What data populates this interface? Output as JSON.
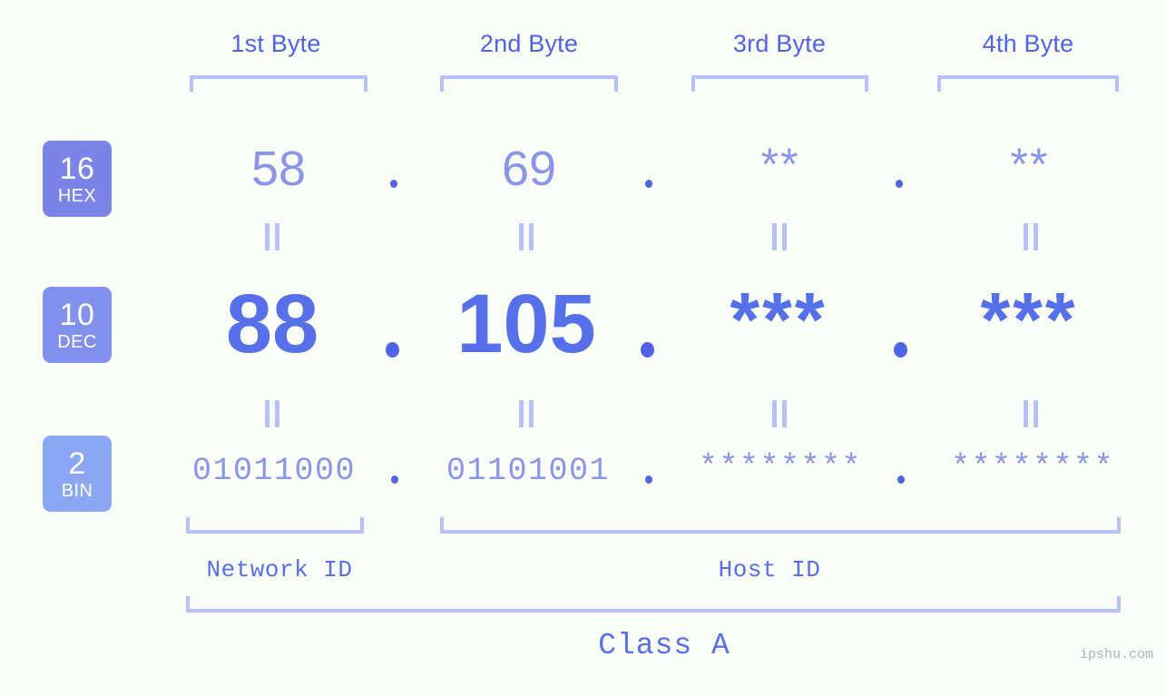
{
  "meta": {
    "background_color": "#fbfdf8",
    "accent_color": "#5570e8",
    "light_accent_color": "#8b95e8",
    "bracket_color": "#b6c0fb",
    "watermark": "ipshu.com"
  },
  "byte_headers": [
    {
      "label": "1st Byte"
    },
    {
      "label": "2nd Byte"
    },
    {
      "label": "3rd Byte"
    },
    {
      "label": "4th Byte"
    }
  ],
  "rows": [
    {
      "badge": {
        "radix": "16",
        "name": "HEX",
        "color": "#7b85e8"
      },
      "values": [
        "58",
        "69",
        "**",
        "**"
      ],
      "separator": "."
    },
    {
      "badge": {
        "radix": "10",
        "name": "DEC",
        "color": "#8290ee"
      },
      "values": [
        "88",
        "105",
        "***",
        "***"
      ],
      "separator": "."
    },
    {
      "badge": {
        "radix": "2",
        "name": "BIN",
        "color": "#8aa6f5"
      },
      "values": [
        "01011000",
        "01101001",
        "********",
        "********"
      ],
      "separator": "."
    }
  ],
  "equals_connector": "||",
  "id_sections": [
    {
      "label": "Network ID"
    },
    {
      "label": "Host ID"
    }
  ],
  "class_label": "Class A"
}
